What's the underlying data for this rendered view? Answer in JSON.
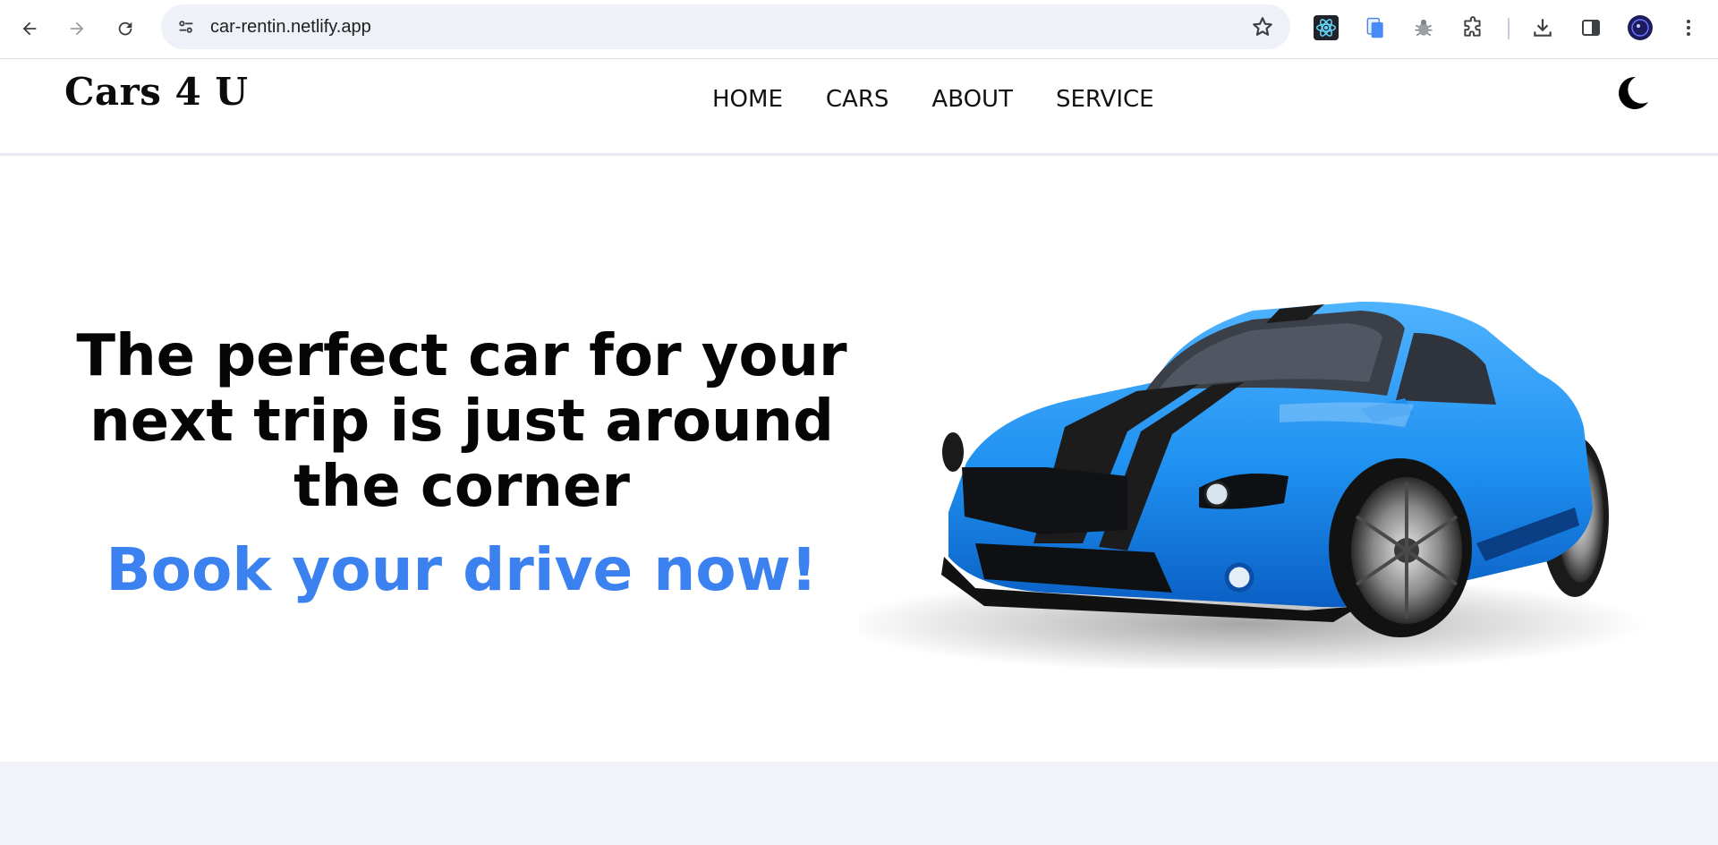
{
  "browser": {
    "url": "car-rentin.netlify.app",
    "icons": [
      "back-arrow-icon",
      "forward-arrow-icon",
      "reload-icon",
      "site-settings-icon",
      "bookmark-star-icon",
      "react-devtools-icon",
      "copy-extension-icon",
      "bug-extension-icon",
      "extensions-puzzle-icon",
      "download-icon",
      "side-panel-icon",
      "profile-avatar",
      "kebab-menu-icon"
    ]
  },
  "site": {
    "logo": "Cars 4 U",
    "nav": [
      {
        "label": "HOME"
      },
      {
        "label": "CARS"
      },
      {
        "label": "ABOUT"
      },
      {
        "label": "SERVICE"
      }
    ],
    "theme_icon": "moon-icon"
  },
  "hero": {
    "title": "The perfect car for your next trip is just around the corner",
    "cta": "Book your drive now!",
    "image": "blue-sports-car-with-black-stripes"
  },
  "colors": {
    "accent": "#3b82f0",
    "car_blue": "#1e90f0",
    "footer_bg": "#f1f3f8",
    "omnibox_bg": "#eef1f7"
  }
}
